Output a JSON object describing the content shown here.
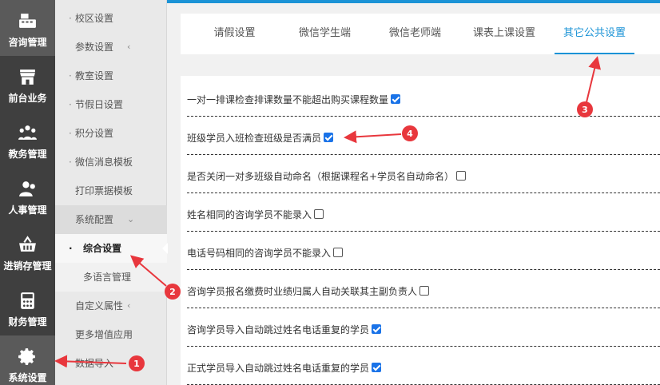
{
  "rail": {
    "items": [
      {
        "label": "咨询管理",
        "icon": "register-icon"
      },
      {
        "label": "前台业务",
        "icon": "storefront-icon"
      },
      {
        "label": "教务管理",
        "icon": "people-group-icon"
      },
      {
        "label": "人事管理",
        "icon": "person-icon"
      },
      {
        "label": "进销存管理",
        "icon": "basket-icon"
      },
      {
        "label": "财务管理",
        "icon": "calculator-icon"
      },
      {
        "label": "系统设置",
        "icon": "gear-icon"
      }
    ]
  },
  "submenu": {
    "items": [
      {
        "label": "校区设置"
      },
      {
        "label": "参数设置"
      },
      {
        "label": "教室设置"
      },
      {
        "label": "节假日设置"
      },
      {
        "label": "积分设置"
      },
      {
        "label": "微信消息模板"
      },
      {
        "label": "打印票据模板"
      },
      {
        "label": "系统配置"
      },
      {
        "label": "综合设置"
      },
      {
        "label": "多语言管理"
      },
      {
        "label": "自定义属性"
      },
      {
        "label": "更多增值应用"
      },
      {
        "label": "数据导入"
      }
    ]
  },
  "tabs": [
    {
      "label": "请假设置"
    },
    {
      "label": "微信学生端"
    },
    {
      "label": "微信老师端"
    },
    {
      "label": "课表上课设置"
    },
    {
      "label": "其它公共设置"
    }
  ],
  "settings": [
    {
      "label": "一对一排课检查排课数量不能超出购买课程数量",
      "checked": true
    },
    {
      "label": "班级学员入班检查班级是否满员",
      "checked": true
    },
    {
      "label": "是否关闭一对多班级自动命名（根据课程名+学员名自动命名）",
      "checked": false
    },
    {
      "label": "姓名相同的咨询学员不能录入",
      "checked": false
    },
    {
      "label": "电话号码相同的咨询学员不能录入",
      "checked": false
    },
    {
      "label": "咨询学员报名缴费时业绩归属人自动关联其主副负责人",
      "checked": false
    },
    {
      "label": "咨询学员导入自动跳过姓名电话重复的学员",
      "checked": true
    },
    {
      "label": "正式学员导入自动跳过姓名电话重复的学员",
      "checked": true
    }
  ],
  "annotations": [
    "1",
    "2",
    "3",
    "4"
  ],
  "colors": {
    "accent": "#1b93d6",
    "annotation": "#e8373d",
    "rail": "#3f3f3f"
  }
}
